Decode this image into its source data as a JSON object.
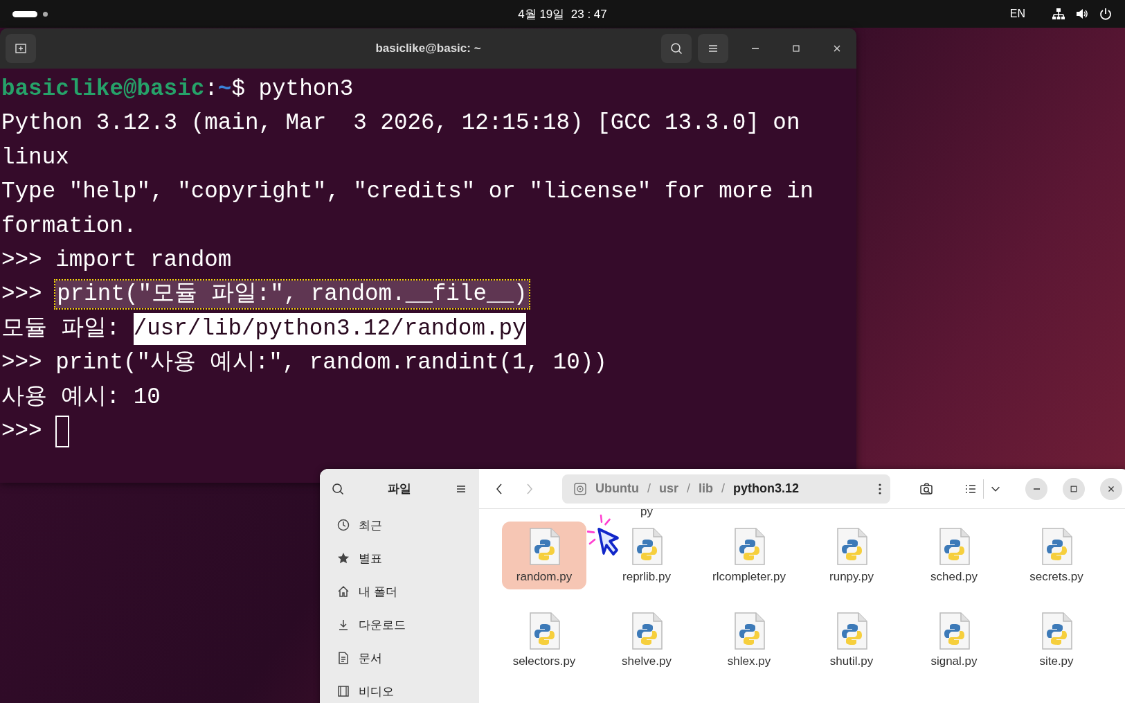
{
  "top_bar": {
    "clock": "4월 19일  23 : 47",
    "input_method": "EN"
  },
  "terminal": {
    "title": "basiclike@basic: ~",
    "lines": [
      {
        "kind": "shell",
        "user": "basiclike@basic",
        "separator": ":",
        "path": "~",
        "symbol": "$",
        "command": "python3"
      },
      {
        "kind": "output",
        "text": "Python 3.12.3 (main, Mar  3 2026, 12:15:18) [GCC 13.3.0] on"
      },
      {
        "kind": "output",
        "text": "linux"
      },
      {
        "kind": "output",
        "text": "Type \"help\", \"copyright\", \"credits\" or \"license\" for more in"
      },
      {
        "kind": "output",
        "text": "formation."
      },
      {
        "kind": "repl",
        "prompt": ">>>",
        "code": "import random",
        "marked": false
      },
      {
        "kind": "repl",
        "prompt": ">>>",
        "code": "print(\"모듈 파일:\", random.__file__)",
        "marked": true
      },
      {
        "kind": "output",
        "text": "모듈 파일:",
        "selection": "/usr/lib/python3.12/random.py"
      },
      {
        "kind": "repl",
        "prompt": ">>>",
        "code": "print(\"사용 예시:\", random.randint(1, 10))",
        "marked": false
      },
      {
        "kind": "output",
        "text": "사용 예시: 10"
      },
      {
        "kind": "repl",
        "prompt": ">>>",
        "cursor": true
      }
    ]
  },
  "files": {
    "title": "파일",
    "sidebar": [
      {
        "label": "최근",
        "kind": "clock"
      },
      {
        "label": "별표",
        "kind": "star"
      },
      {
        "label": "내 폴더",
        "kind": "home"
      },
      {
        "label": "다운로드",
        "kind": "download"
      },
      {
        "label": "문서",
        "kind": "document"
      },
      {
        "label": "비디오",
        "kind": "video"
      }
    ],
    "path": [
      {
        "label": "Ubuntu",
        "current": false
      },
      {
        "label": "usr",
        "current": false
      },
      {
        "label": "lib",
        "current": false
      },
      {
        "label": "python3.12",
        "current": true
      }
    ],
    "path_separator": "/",
    "cut_label": "py",
    "items": [
      {
        "name": "random.py",
        "selected": true
      },
      {
        "name": "reprlib.py",
        "selected": false
      },
      {
        "name": "rlcompleter.py",
        "selected": false
      },
      {
        "name": "runpy.py",
        "selected": false
      },
      {
        "name": "sched.py",
        "selected": false
      },
      {
        "name": "secrets.py",
        "selected": false
      },
      {
        "name": "selectors.py",
        "selected": false
      },
      {
        "name": "shelve.py",
        "selected": false
      },
      {
        "name": "shlex.py",
        "selected": false
      },
      {
        "name": "shutil.py",
        "selected": false
      },
      {
        "name": "signal.py",
        "selected": false
      },
      {
        "name": "site.py",
        "selected": false
      }
    ]
  }
}
